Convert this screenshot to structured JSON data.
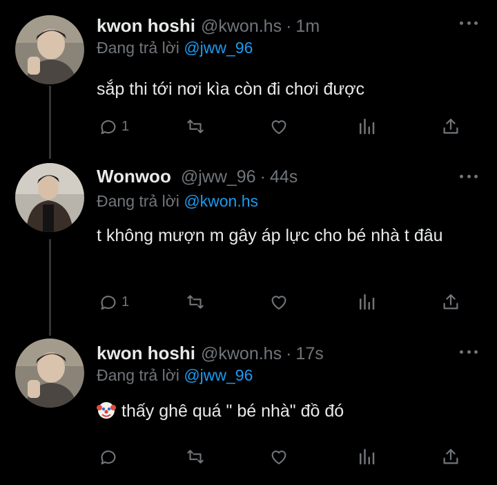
{
  "tweets": [
    {
      "name": "kwon hoshi",
      "handle": "@kwon.hs",
      "time": "1m",
      "replying_prefix": "Đang trả lời",
      "replying_to": "@jww_96",
      "text": "sắp thi tới nơi kìa còn đi chơi được",
      "reply_count": "1",
      "avatar_icon": "person-photo-avatar"
    },
    {
      "name": "Wonwoo",
      "handle": "@jww_96",
      "time": "44s",
      "replying_prefix": "Đang trả lời",
      "replying_to": "@kwon.hs",
      "text": "t không mượn m gây áp lực cho bé nhà t đâu",
      "reply_count": "1",
      "avatar_icon": "person-photo-avatar"
    },
    {
      "name": "kwon hoshi",
      "handle": "@kwon.hs",
      "time": "17s",
      "replying_prefix": "Đang trả lời",
      "replying_to": "@jww_96",
      "text": "thấy ghê quá \" bé nhà\" đồ đó",
      "reply_count": "",
      "emoji": "clown-face-emoji",
      "avatar_icon": "person-photo-avatar"
    }
  ],
  "colors": {
    "background": "#000000",
    "text": "#e7e9ea",
    "muted": "#71767b",
    "link": "#1d9bf0",
    "thread_line": "#333639"
  },
  "time_separator": "·",
  "icons": [
    "reply-icon",
    "retweet-icon",
    "like-icon",
    "views-icon",
    "share-icon",
    "more-icon"
  ]
}
